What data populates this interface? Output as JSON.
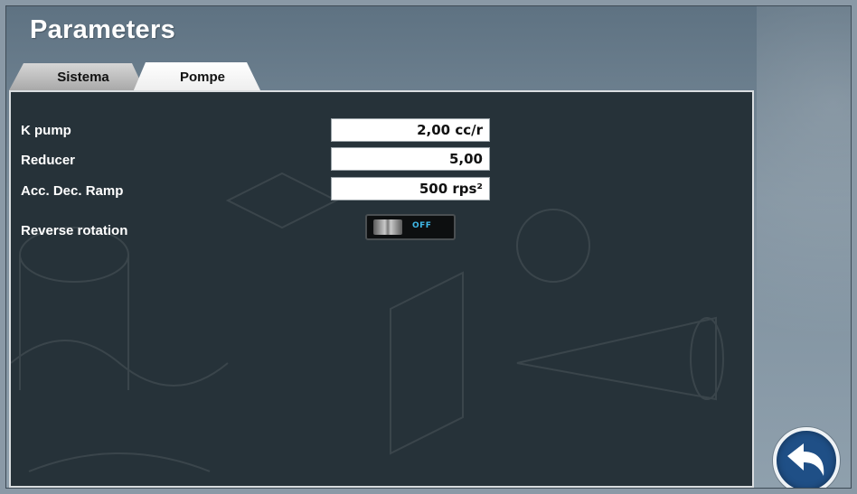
{
  "header": {
    "title": "Parameters"
  },
  "tabs": [
    {
      "label": "Sistema",
      "active": false
    },
    {
      "label": "Pompe",
      "active": true
    }
  ],
  "params": {
    "k_pump": {
      "label": "K pump",
      "value": "2,00 cc/r"
    },
    "reducer": {
      "label": "Reducer",
      "value": "5,00"
    },
    "acc_dec_ramp": {
      "label": "Acc. Dec. Ramp",
      "value": "500 rps²"
    },
    "reverse_rotation": {
      "label": "Reverse rotation",
      "state": "OFF"
    }
  },
  "icons": {
    "back": "undo-arrow-icon"
  },
  "colors": {
    "panel_bg": "#263239",
    "toggle_state_text": "#3fb8e8",
    "back_button_bg": "#1f4f86"
  }
}
